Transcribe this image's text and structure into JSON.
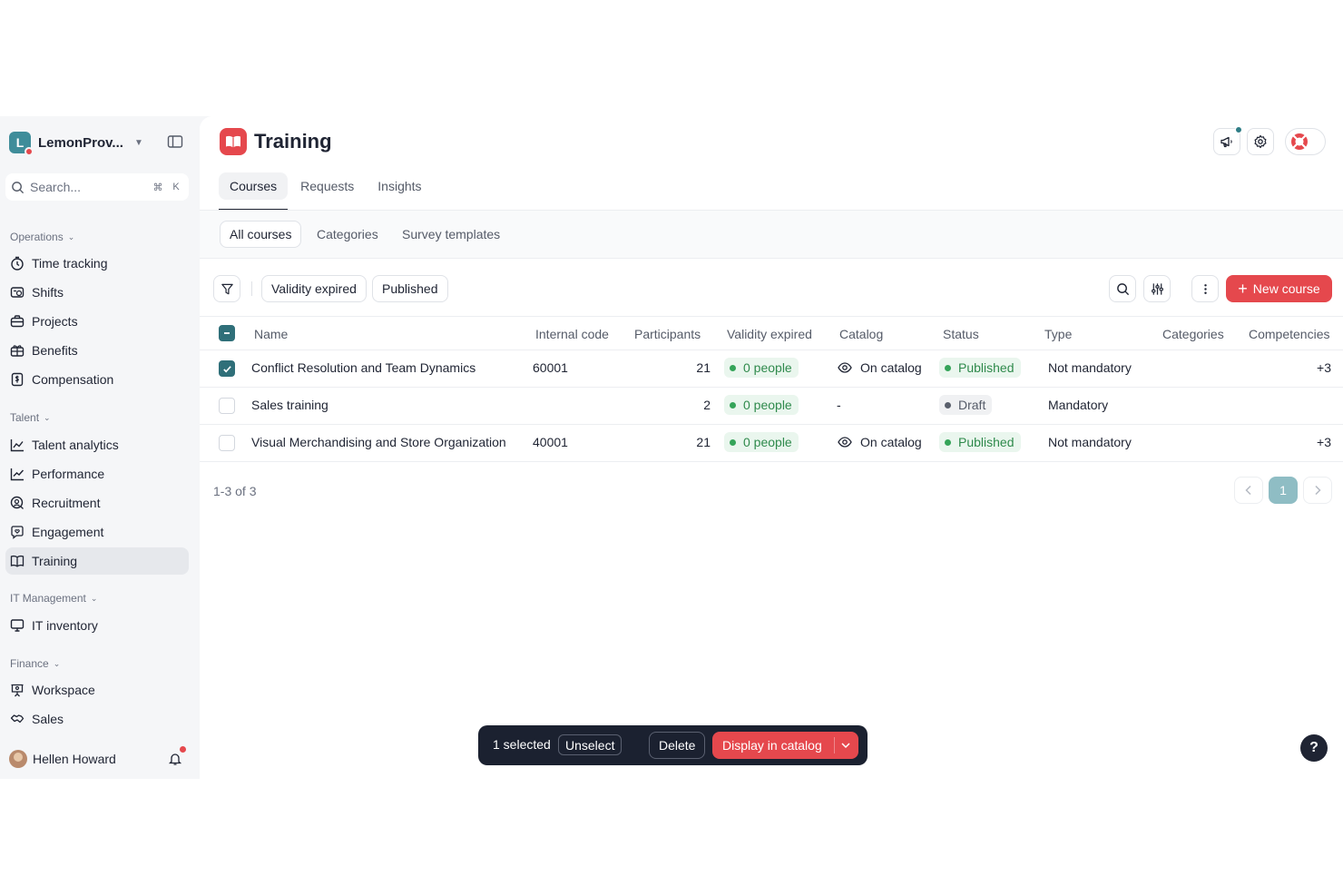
{
  "workspace": {
    "initial": "L",
    "name": "LemonProv..."
  },
  "search": {
    "placeholder": "Search...",
    "shortcut_mod": "⌘",
    "shortcut_key": "K"
  },
  "sidebar": {
    "sections": [
      {
        "label": "Operations",
        "items": [
          "Time tracking",
          "Shifts",
          "Projects",
          "Benefits",
          "Compensation"
        ]
      },
      {
        "label": "Talent",
        "items": [
          "Talent analytics",
          "Performance",
          "Recruitment",
          "Engagement",
          "Training"
        ]
      },
      {
        "label": "IT Management",
        "items": [
          "IT inventory"
        ]
      },
      {
        "label": "Finance",
        "items": [
          "Workspace",
          "Sales"
        ]
      }
    ],
    "active_item": "Training"
  },
  "user": {
    "name": "Hellen Howard"
  },
  "page": {
    "title": "Training"
  },
  "tabs": [
    "Courses",
    "Requests",
    "Insights"
  ],
  "active_tab": "Courses",
  "subtabs": [
    "All courses",
    "Categories",
    "Survey templates"
  ],
  "active_subtab": "All courses",
  "filters": [
    "Validity expired",
    "Published"
  ],
  "new_course_label": "New course",
  "table": {
    "columns": [
      "Name",
      "Internal code",
      "Participants",
      "Validity expired",
      "Catalog",
      "Status",
      "Type",
      "Categories",
      "Competencies"
    ],
    "rows": [
      {
        "checked": true,
        "name": "Conflict Resolution and Team Dynamics",
        "code": "60001",
        "participants": "21",
        "validity": "0 people",
        "catalog": "On catalog",
        "status": "Published",
        "type": "Not mandatory",
        "categories": "",
        "competencies": "+3"
      },
      {
        "checked": false,
        "name": "Sales training",
        "code": "",
        "participants": "2",
        "validity": "0 people",
        "catalog": "-",
        "status": "Draft",
        "type": "Mandatory",
        "categories": "",
        "competencies": ""
      },
      {
        "checked": false,
        "name": "Visual Merchandising and Store Organization",
        "code": "40001",
        "participants": "21",
        "validity": "0 people",
        "catalog": "On catalog",
        "status": "Published",
        "type": "Not mandatory",
        "categories": "",
        "competencies": "+3"
      }
    ]
  },
  "pagination": {
    "summary": "1-3 of 3",
    "current_page": "1"
  },
  "action_bar": {
    "selected": "1 selected",
    "unselect": "Unselect",
    "delete": "Delete",
    "display": "Display in catalog"
  },
  "help": "?",
  "colors": {
    "accent": "#e5484d",
    "teal": "#2f6f79",
    "published": "#2f8a4c"
  }
}
